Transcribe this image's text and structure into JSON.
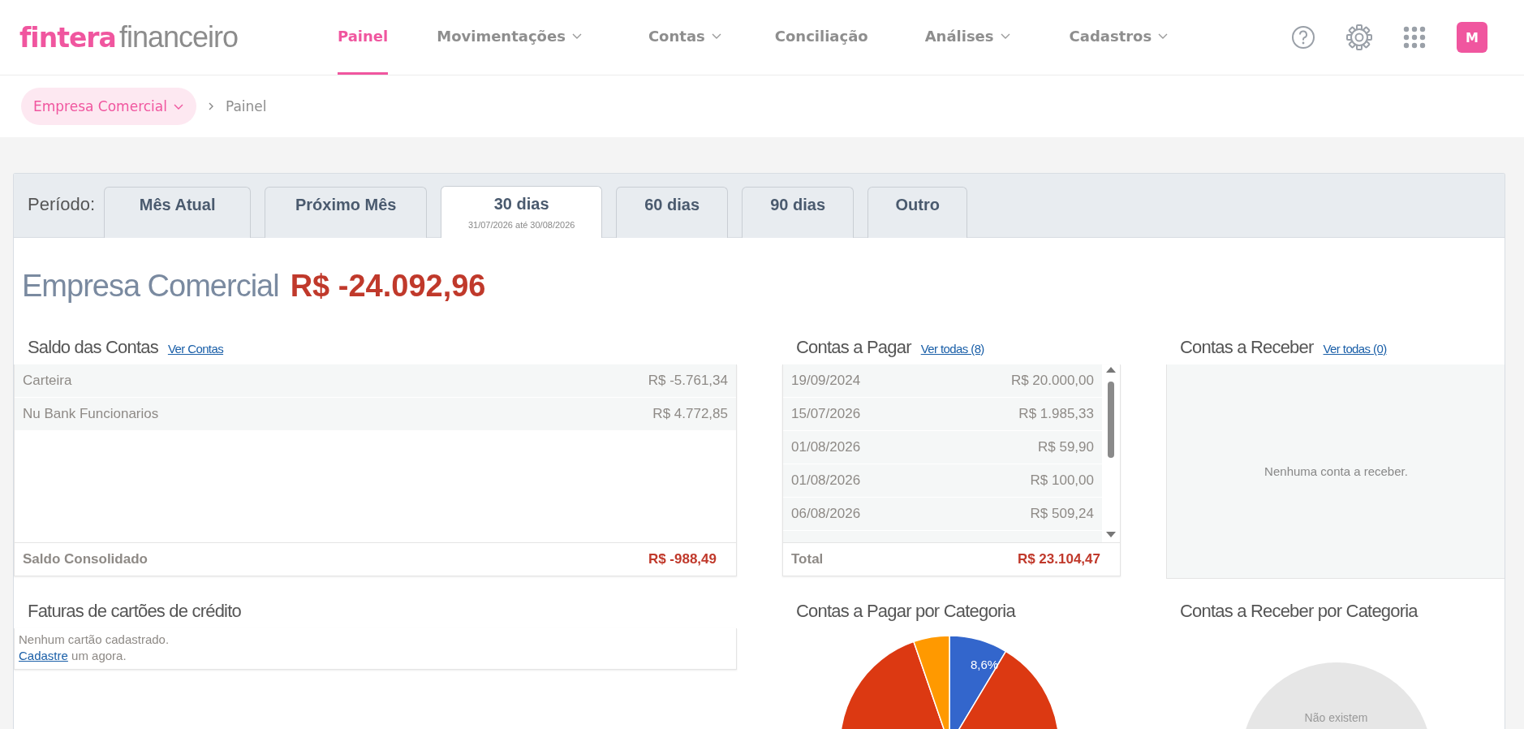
{
  "header": {
    "logo_brand": "fintera",
    "logo_product": "financeiro",
    "nav": [
      {
        "label": "Painel",
        "selected": true,
        "dropdown": false
      },
      {
        "label": "Movimentações",
        "selected": false,
        "dropdown": true
      },
      {
        "label": "Contas",
        "selected": false,
        "dropdown": true
      },
      {
        "label": "Conciliação",
        "selected": false,
        "dropdown": false
      },
      {
        "label": "Análises",
        "selected": false,
        "dropdown": true
      },
      {
        "label": "Cadastros",
        "selected": false,
        "dropdown": true
      }
    ],
    "avatar": "M"
  },
  "breadcrumb": {
    "company": "Empresa Comercial",
    "current": "Painel"
  },
  "period": {
    "label": "Período:",
    "tabs": [
      {
        "label": "Mês Atual",
        "selected": false
      },
      {
        "label": "Próximo Mês",
        "selected": false
      },
      {
        "label": "30 dias",
        "selected": true,
        "range": "31/07/2026 até 30/08/2026"
      },
      {
        "label": "60 dias",
        "selected": false
      },
      {
        "label": "90 dias",
        "selected": false
      },
      {
        "label": "Outro",
        "selected": false
      }
    ]
  },
  "company": {
    "name": "Empresa Comercial",
    "balance": "R$ -24.092,96"
  },
  "saldo": {
    "title": "Saldo das Contas",
    "link": "Ver Contas",
    "rows": [
      {
        "name": "Carteira",
        "value": "R$ -5.761,34"
      },
      {
        "name": "Nu Bank Funcionarios",
        "value": "R$ 4.772,85"
      }
    ],
    "total_label": "Saldo Consolidado",
    "total_value": "R$ -988,49"
  },
  "pagar": {
    "title": "Contas a Pagar",
    "link": "Ver todas (8)",
    "rows": [
      {
        "date": "19/09/2024",
        "value": "R$ 20.000,00"
      },
      {
        "date": "15/07/2026",
        "value": "R$ 1.985,33"
      },
      {
        "date": "01/08/2026",
        "value": "R$ 59,90"
      },
      {
        "date": "01/08/2026",
        "value": "R$ 100,00"
      },
      {
        "date": "06/08/2026",
        "value": "R$ 509,24"
      }
    ],
    "total_label": "Total",
    "total_value": "R$ 23.104,47"
  },
  "receber": {
    "title": "Contas a Receber",
    "link": "Ver todas (0)",
    "empty": "Nenhuma conta a receber."
  },
  "cartoes": {
    "title": "Faturas de cartões de crédito",
    "empty": "Nenhum cartão cadastrado.",
    "link": "Cadastre",
    "after": " um agora."
  },
  "pagar_categoria": {
    "title": "Contas a Pagar por Categoria",
    "slice_label": "8,6%"
  },
  "receber_categoria": {
    "title": "Contas a Receber por Categoria",
    "empty": "Não existem"
  }
}
